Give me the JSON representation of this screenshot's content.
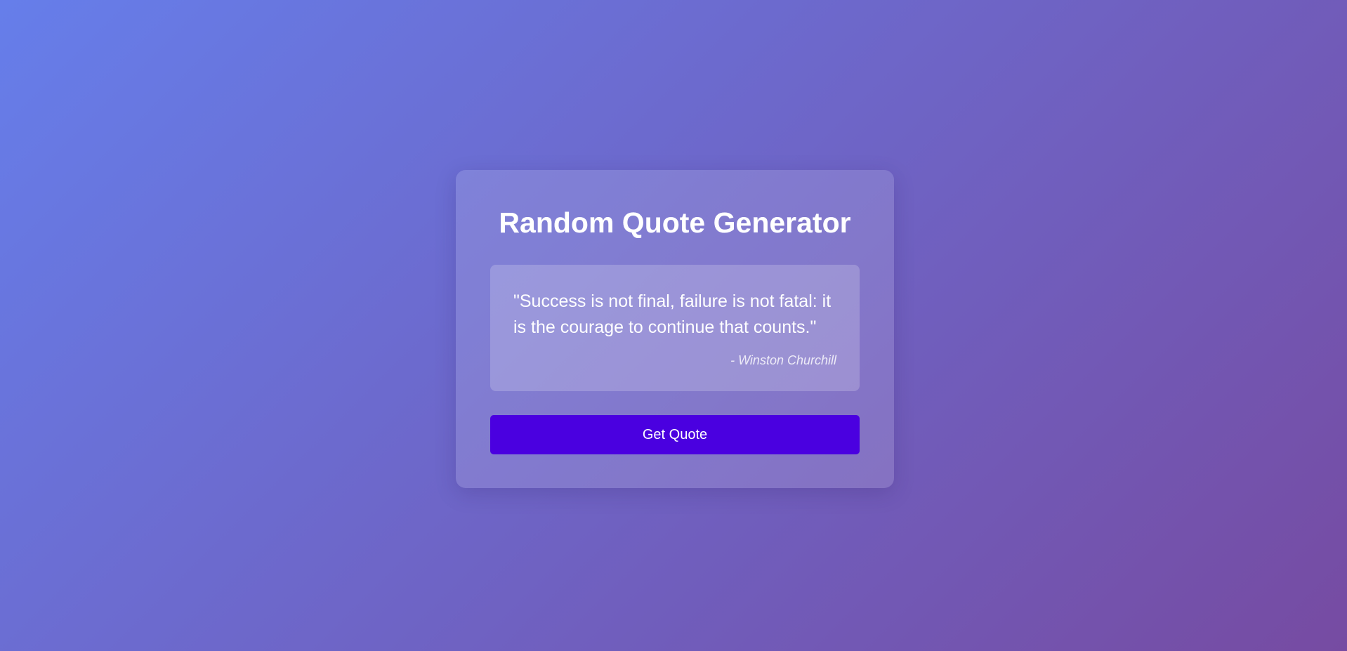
{
  "app": {
    "title": "Random Quote Generator"
  },
  "quote": {
    "text": "\"Success is not final, failure is not fatal: it is the courage to continue that counts.\"",
    "author": "- Winston Churchill"
  },
  "actions": {
    "get_quote_label": "Get Quote"
  },
  "colors": {
    "background_start": "#667eea",
    "background_end": "#764ba2",
    "button": "#4a00e0",
    "text": "#ffffff"
  }
}
